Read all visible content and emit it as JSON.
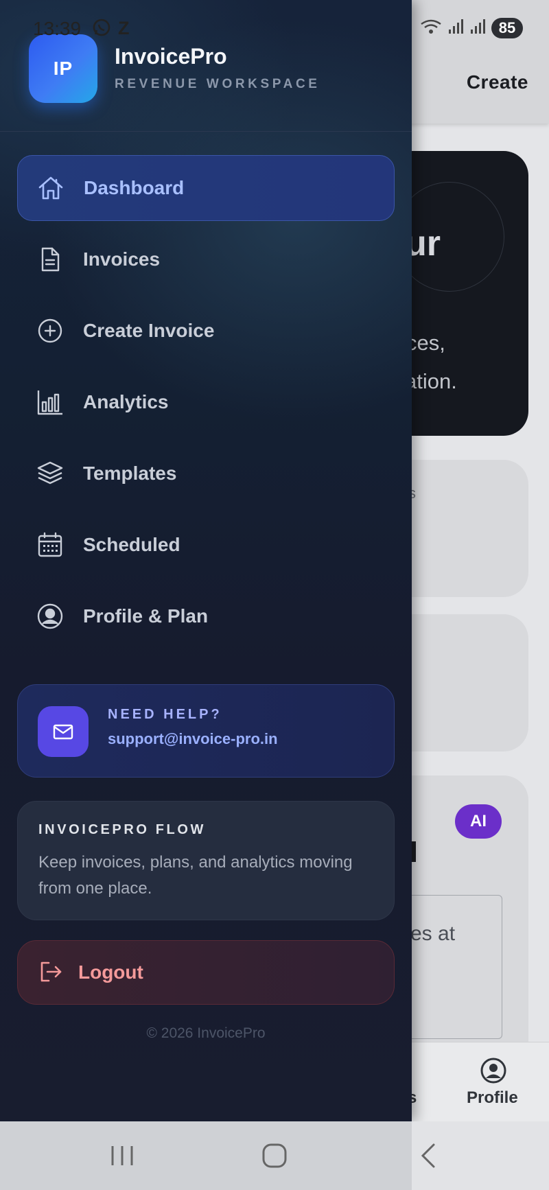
{
  "status_bar": {
    "time": "13:39",
    "extra_letter": "Z",
    "battery": "85"
  },
  "background_app": {
    "topbar_action": "Create",
    "hero_partial_title": "ur",
    "hero_partial_line1": "ces,",
    "hero_partial_line2": "ation.",
    "card1_partial": "s",
    "ai_badge": "AI",
    "textbox_partial": "es at",
    "bottom_nav_partial": "s",
    "bottom_nav_profile": "Profile"
  },
  "drawer": {
    "brand": {
      "logo_text": "IP",
      "name": "InvoicePro",
      "subtitle": "REVENUE WORKSPACE"
    },
    "nav_items": [
      {
        "label": "Dashboard",
        "icon": "home-icon",
        "active": true
      },
      {
        "label": "Invoices",
        "icon": "document-icon",
        "active": false
      },
      {
        "label": "Create Invoice",
        "icon": "plus-circle-icon",
        "active": false
      },
      {
        "label": "Analytics",
        "icon": "bar-chart-icon",
        "active": false
      },
      {
        "label": "Templates",
        "icon": "layers-icon",
        "active": false
      },
      {
        "label": "Scheduled",
        "icon": "calendar-icon",
        "active": false
      },
      {
        "label": "Profile & Plan",
        "icon": "user-circle-icon",
        "active": false
      }
    ],
    "help": {
      "title": "NEED HELP?",
      "email": "support@invoice-pro.in",
      "icon": "mail-icon"
    },
    "flow": {
      "title": "INVOICEPRO FLOW",
      "text": "Keep invoices, plans, and analytics moving from one place."
    },
    "logout": {
      "label": "Logout",
      "icon": "logout-icon"
    },
    "copyright": "© 2026 InvoicePro"
  },
  "colors": {
    "accent": "#5748e4",
    "active_nav_text": "#a9c0ff",
    "logout_text": "#f49a9a",
    "drawer_bg": "#151d30"
  }
}
